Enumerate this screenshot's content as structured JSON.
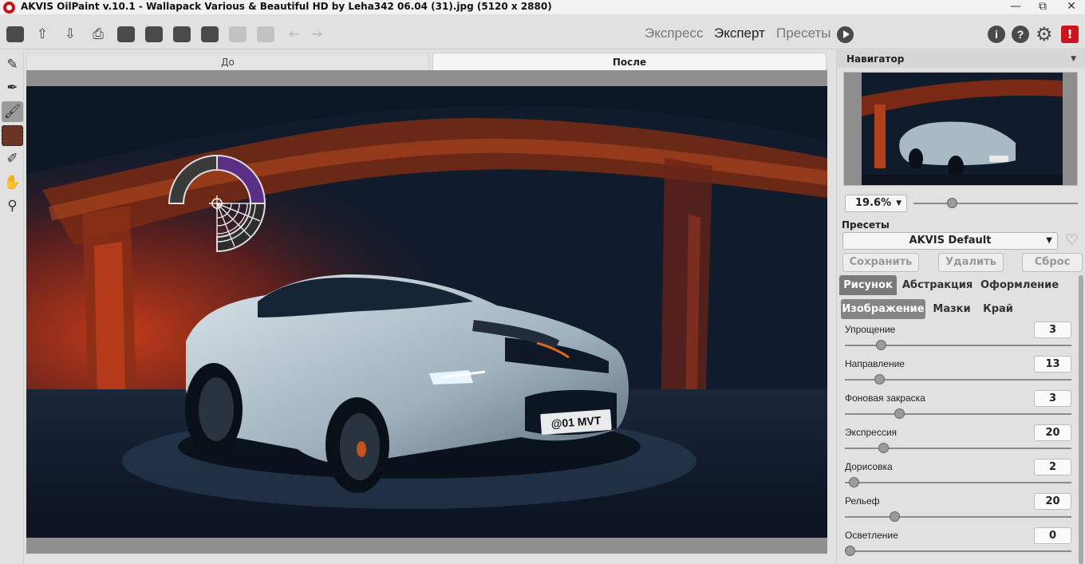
{
  "window": {
    "title": "AKVIS OilPaint v.10.1 - Wallapack Various & Beautiful HD by Leha342 06.04 (31).jpg (5120 x 2880)",
    "minimize": "—",
    "maximize": "⧉",
    "close": "✕"
  },
  "toolbar": {
    "modes": {
      "express": "Экспресс",
      "expert": "Эксперт",
      "presets": "Пресеты"
    },
    "help_i": "i",
    "help_q": "?",
    "alert": "!"
  },
  "canvas": {
    "tab_before": "До",
    "tab_after": "После",
    "license_plate": "@01 MVT"
  },
  "navigator": {
    "header": "Навигатор",
    "zoom": "19.6%",
    "zoom_level": 0.2
  },
  "presets": {
    "label": "Пресеты",
    "selected": "AKVIS Default",
    "save": "Сохранить",
    "delete": "Удалить",
    "reset": "Сброс"
  },
  "tabs": {
    "main": [
      "Рисунок",
      "Абстракция",
      "Оформление"
    ],
    "sub": [
      "Изображение",
      "Мазки",
      "Край"
    ]
  },
  "params": [
    {
      "label": "Упрощение",
      "value": "3",
      "level": 0.16
    },
    {
      "label": "Направление",
      "value": "13",
      "level": 0.15
    },
    {
      "label": "Фоновая закраска",
      "value": "3",
      "level": 0.24
    },
    {
      "label": "Экспрессия",
      "value": "20",
      "level": 0.17
    },
    {
      "label": "Дорисовка",
      "value": "2",
      "level": 0.04
    },
    {
      "label": "Рельеф",
      "value": "20",
      "level": 0.22
    },
    {
      "label": "Осветление",
      "value": "0",
      "level": 0.02
    }
  ]
}
